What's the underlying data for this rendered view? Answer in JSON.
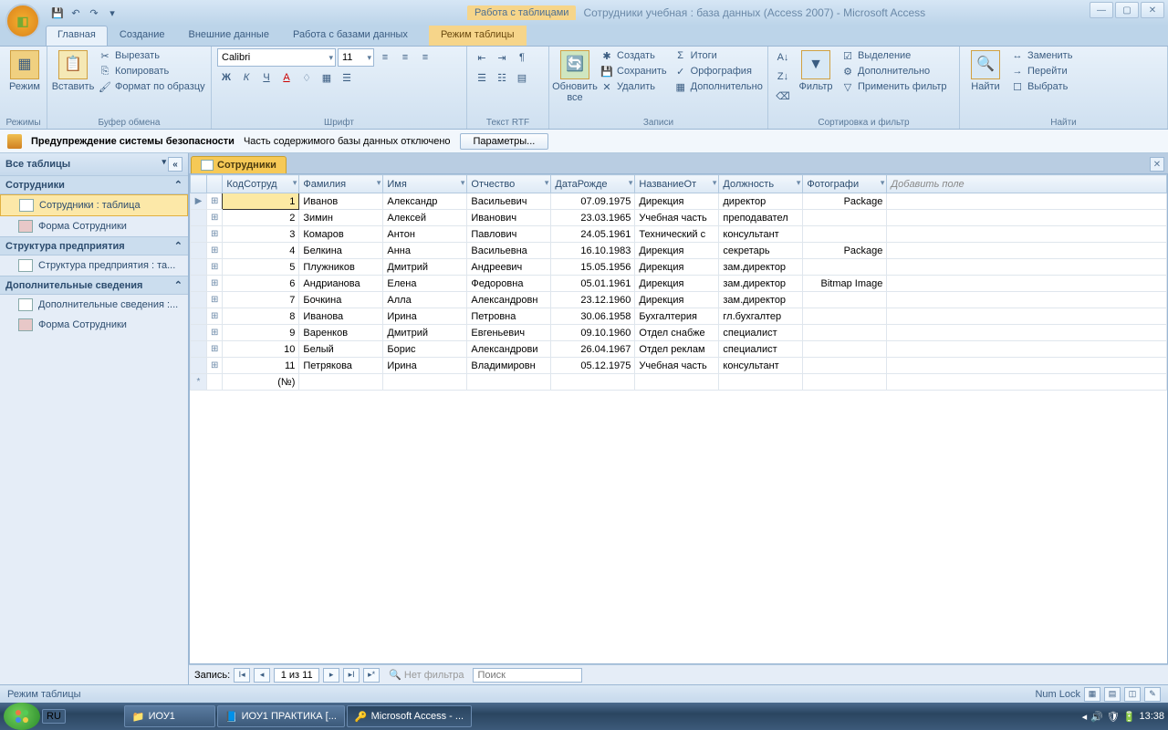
{
  "title": {
    "context_tab": "Работа с таблицами",
    "app": "Сотрудники учебная : база данных (Access 2007) - Microsoft Access"
  },
  "tabs": {
    "home": "Главная",
    "create": "Создание",
    "external": "Внешние данные",
    "dbtools": "Работа с базами данных",
    "datasheet": "Режим таблицы"
  },
  "ribbon": {
    "view": "Режим",
    "views_group": "Режимы",
    "paste": "Вставить",
    "cut": "Вырезать",
    "copy": "Копировать",
    "format_painter": "Формат по образцу",
    "clipboard_group": "Буфер обмена",
    "font_name": "Calibri",
    "font_size": "11",
    "font_group": "Шрифт",
    "richtext_group": "Текст RTF",
    "refresh": "Обновить все",
    "new": "Создать",
    "save": "Сохранить",
    "delete": "Удалить",
    "totals": "Итоги",
    "spelling": "Орфография",
    "more": "Дополнительно",
    "records_group": "Записи",
    "filter": "Фильтр",
    "selection": "Выделение",
    "advanced": "Дополнительно",
    "toggle_filter": "Применить фильтр",
    "sortfilter_group": "Сортировка и фильтр",
    "find": "Найти",
    "replace": "Заменить",
    "goto": "Перейти",
    "select": "Выбрать",
    "find_group": "Найти"
  },
  "security": {
    "title": "Предупреждение системы безопасности",
    "msg": "Часть содержимого базы данных отключено",
    "btn": "Параметры..."
  },
  "nav": {
    "header": "Все таблицы",
    "g1": "Сотрудники",
    "g1_i1": "Сотрудники : таблица",
    "g1_i2": "Форма Сотрудники",
    "g2": "Структура предприятия",
    "g2_i1": "Структура предприятия : та...",
    "g3": "Дополнительные сведения",
    "g3_i1": "Дополнительные сведения :...",
    "g3_i2": "Форма Сотрудники"
  },
  "doc_tab": "Сотрудники",
  "columns": {
    "c1": "КодСотруд",
    "c2": "Фамилия",
    "c3": "Имя",
    "c4": "Отчество",
    "c5": "ДатаРожде",
    "c6": "НазваниеОт",
    "c7": "Должность",
    "c8": "Фотографи",
    "add": "Добавить поле"
  },
  "rows": [
    {
      "id": "1",
      "fam": "Иванов",
      "im": "Александр",
      "ot": "Васильевич",
      "dob": "07.09.1975",
      "dep": "Дирекция",
      "pos": "директор",
      "ph": "Package"
    },
    {
      "id": "2",
      "fam": "Зимин",
      "im": "Алексей",
      "ot": "Иванович",
      "dob": "23.03.1965",
      "dep": "Учебная часть",
      "pos": "преподавател",
      "ph": ""
    },
    {
      "id": "3",
      "fam": "Комаров",
      "im": "Антон",
      "ot": "Павлович",
      "dob": "24.05.1961",
      "dep": "Технический с",
      "pos": "консультант",
      "ph": ""
    },
    {
      "id": "4",
      "fam": "Белкина",
      "im": "Анна",
      "ot": "Васильевна",
      "dob": "16.10.1983",
      "dep": "Дирекция",
      "pos": "секретарь",
      "ph": "Package"
    },
    {
      "id": "5",
      "fam": "Плужников",
      "im": "Дмитрий",
      "ot": "Андреевич",
      "dob": "15.05.1956",
      "dep": "Дирекция",
      "pos": "зам.директор",
      "ph": ""
    },
    {
      "id": "6",
      "fam": "Андрианова",
      "im": "Елена",
      "ot": "Федоровна",
      "dob": "05.01.1961",
      "dep": "Дирекция",
      "pos": "зам.директор",
      "ph": "Bitmap Image"
    },
    {
      "id": "7",
      "fam": "Бочкина",
      "im": "Алла",
      "ot": "Александровн",
      "dob": "23.12.1960",
      "dep": "Дирекция",
      "pos": "зам.директор",
      "ph": ""
    },
    {
      "id": "8",
      "fam": "Иванова",
      "im": "Ирина",
      "ot": "Петровна",
      "dob": "30.06.1958",
      "dep": "Бухгалтерия",
      "pos": "гл.бухгалтер",
      "ph": ""
    },
    {
      "id": "9",
      "fam": "Варенков",
      "im": "Дмитрий",
      "ot": "Евгеньевич",
      "dob": "09.10.1960",
      "dep": "Отдел снабже",
      "pos": "специалист",
      "ph": ""
    },
    {
      "id": "10",
      "fam": "Белый",
      "im": "Борис",
      "ot": "Александрови",
      "dob": "26.04.1967",
      "dep": "Отдел реклам",
      "pos": "специалист",
      "ph": ""
    },
    {
      "id": "11",
      "fam": "Петрякова",
      "im": "Ирина",
      "ot": "Владимировн",
      "dob": "05.12.1975",
      "dep": "Учебная часть",
      "pos": "консультант",
      "ph": ""
    }
  ],
  "new_row_id": "(№)",
  "recnav": {
    "label": "Запись:",
    "pos": "1 из 11",
    "nofilter": "Нет фильтра",
    "search": "Поиск"
  },
  "status": {
    "mode": "Режим таблицы",
    "numlock": "Num Lock"
  },
  "taskbar": {
    "lang": "RU",
    "t1": "ИОУ1",
    "t2": "ИОУ1 ПРАКТИКА [...",
    "t3": "Microsoft Access - ...",
    "time": "13:38"
  }
}
